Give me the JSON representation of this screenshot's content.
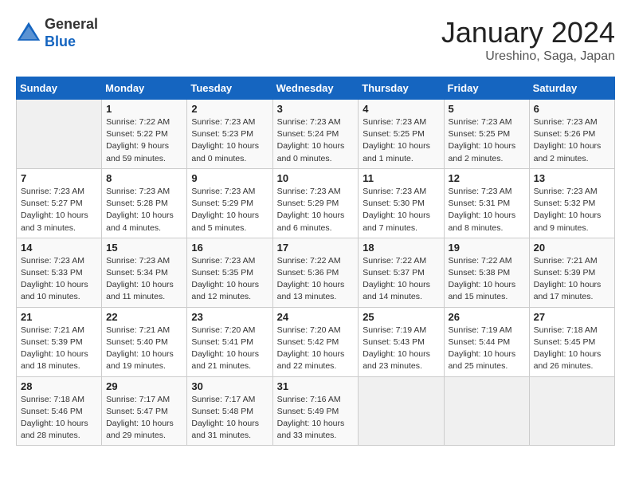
{
  "header": {
    "logo_general": "General",
    "logo_blue": "Blue",
    "title": "January 2024",
    "subtitle": "Ureshino, Saga, Japan"
  },
  "weekdays": [
    "Sunday",
    "Monday",
    "Tuesday",
    "Wednesday",
    "Thursday",
    "Friday",
    "Saturday"
  ],
  "weeks": [
    [
      {
        "num": "",
        "empty": true
      },
      {
        "num": "1",
        "rise": "7:22 AM",
        "set": "5:22 PM",
        "daylight": "9 hours and 59 minutes."
      },
      {
        "num": "2",
        "rise": "7:23 AM",
        "set": "5:23 PM",
        "daylight": "10 hours and 0 minutes."
      },
      {
        "num": "3",
        "rise": "7:23 AM",
        "set": "5:24 PM",
        "daylight": "10 hours and 0 minutes."
      },
      {
        "num": "4",
        "rise": "7:23 AM",
        "set": "5:25 PM",
        "daylight": "10 hours and 1 minute."
      },
      {
        "num": "5",
        "rise": "7:23 AM",
        "set": "5:25 PM",
        "daylight": "10 hours and 2 minutes."
      },
      {
        "num": "6",
        "rise": "7:23 AM",
        "set": "5:26 PM",
        "daylight": "10 hours and 2 minutes."
      }
    ],
    [
      {
        "num": "7",
        "rise": "7:23 AM",
        "set": "5:27 PM",
        "daylight": "10 hours and 3 minutes."
      },
      {
        "num": "8",
        "rise": "7:23 AM",
        "set": "5:28 PM",
        "daylight": "10 hours and 4 minutes."
      },
      {
        "num": "9",
        "rise": "7:23 AM",
        "set": "5:29 PM",
        "daylight": "10 hours and 5 minutes."
      },
      {
        "num": "10",
        "rise": "7:23 AM",
        "set": "5:29 PM",
        "daylight": "10 hours and 6 minutes."
      },
      {
        "num": "11",
        "rise": "7:23 AM",
        "set": "5:30 PM",
        "daylight": "10 hours and 7 minutes."
      },
      {
        "num": "12",
        "rise": "7:23 AM",
        "set": "5:31 PM",
        "daylight": "10 hours and 8 minutes."
      },
      {
        "num": "13",
        "rise": "7:23 AM",
        "set": "5:32 PM",
        "daylight": "10 hours and 9 minutes."
      }
    ],
    [
      {
        "num": "14",
        "rise": "7:23 AM",
        "set": "5:33 PM",
        "daylight": "10 hours and 10 minutes."
      },
      {
        "num": "15",
        "rise": "7:23 AM",
        "set": "5:34 PM",
        "daylight": "10 hours and 11 minutes."
      },
      {
        "num": "16",
        "rise": "7:23 AM",
        "set": "5:35 PM",
        "daylight": "10 hours and 12 minutes."
      },
      {
        "num": "17",
        "rise": "7:22 AM",
        "set": "5:36 PM",
        "daylight": "10 hours and 13 minutes."
      },
      {
        "num": "18",
        "rise": "7:22 AM",
        "set": "5:37 PM",
        "daylight": "10 hours and 14 minutes."
      },
      {
        "num": "19",
        "rise": "7:22 AM",
        "set": "5:38 PM",
        "daylight": "10 hours and 15 minutes."
      },
      {
        "num": "20",
        "rise": "7:21 AM",
        "set": "5:39 PM",
        "daylight": "10 hours and 17 minutes."
      }
    ],
    [
      {
        "num": "21",
        "rise": "7:21 AM",
        "set": "5:39 PM",
        "daylight": "10 hours and 18 minutes."
      },
      {
        "num": "22",
        "rise": "7:21 AM",
        "set": "5:40 PM",
        "daylight": "10 hours and 19 minutes."
      },
      {
        "num": "23",
        "rise": "7:20 AM",
        "set": "5:41 PM",
        "daylight": "10 hours and 21 minutes."
      },
      {
        "num": "24",
        "rise": "7:20 AM",
        "set": "5:42 PM",
        "daylight": "10 hours and 22 minutes."
      },
      {
        "num": "25",
        "rise": "7:19 AM",
        "set": "5:43 PM",
        "daylight": "10 hours and 23 minutes."
      },
      {
        "num": "26",
        "rise": "7:19 AM",
        "set": "5:44 PM",
        "daylight": "10 hours and 25 minutes."
      },
      {
        "num": "27",
        "rise": "7:18 AM",
        "set": "5:45 PM",
        "daylight": "10 hours and 26 minutes."
      }
    ],
    [
      {
        "num": "28",
        "rise": "7:18 AM",
        "set": "5:46 PM",
        "daylight": "10 hours and 28 minutes."
      },
      {
        "num": "29",
        "rise": "7:17 AM",
        "set": "5:47 PM",
        "daylight": "10 hours and 29 minutes."
      },
      {
        "num": "30",
        "rise": "7:17 AM",
        "set": "5:48 PM",
        "daylight": "10 hours and 31 minutes."
      },
      {
        "num": "31",
        "rise": "7:16 AM",
        "set": "5:49 PM",
        "daylight": "10 hours and 33 minutes."
      },
      {
        "num": "",
        "empty": true
      },
      {
        "num": "",
        "empty": true
      },
      {
        "num": "",
        "empty": true
      }
    ]
  ]
}
